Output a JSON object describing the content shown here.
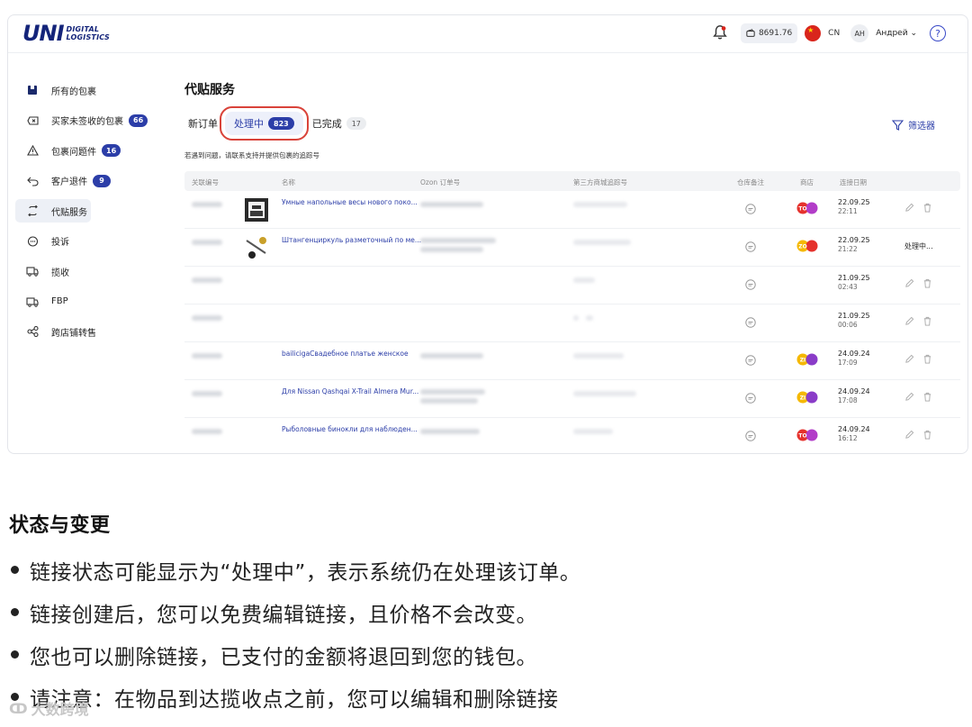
{
  "header": {
    "logo_main": "UNI",
    "logo_line1": "DIGITAL",
    "logo_line2": "LOGISTICS",
    "balance": "8691.76",
    "language": "CN",
    "avatar_initials": "AH",
    "username": "Андрей",
    "help_label": "?"
  },
  "sidebar": {
    "items": [
      {
        "label": "所有的包裹",
        "icon": "box-icon"
      },
      {
        "label": "买家未签收的包裹",
        "icon": "cancel-box-icon",
        "badge": "66"
      },
      {
        "label": "包裹问题件",
        "icon": "warning-icon",
        "badge": "16"
      },
      {
        "label": "客户退件",
        "icon": "return-icon",
        "badge": "9"
      },
      {
        "label": "代贴服务",
        "icon": "relabel-icon",
        "active": true
      },
      {
        "label": "投诉",
        "icon": "complaint-icon"
      },
      {
        "label": "揽收",
        "icon": "truck-icon"
      },
      {
        "label": "FBP",
        "icon": "fbp-truck-icon"
      },
      {
        "label": "跨店铺转售",
        "icon": "share-icon"
      }
    ]
  },
  "main": {
    "title": "代贴服务",
    "tabs": [
      {
        "label": "新订单"
      },
      {
        "label": "处理中",
        "count": "823"
      },
      {
        "label": "已完成",
        "count": "17"
      }
    ],
    "filter_label": "筛选器",
    "notice": "若遇到问题，请联系支持并提供包裹的追踪号"
  },
  "table": {
    "columns": [
      "关联编号",
      "名称",
      "Ozon 订单号",
      "第三方商城追踪号",
      "仓库备注",
      "商店",
      "连接日期"
    ],
    "rows": [
      {
        "name": "Умные напольные весы нового поко...",
        "image": "scale",
        "shop": "TO",
        "date": "22.09.25",
        "time": "22:11",
        "status": ""
      },
      {
        "name": "Штангенциркуль разметочный по ме...",
        "image": "caliper",
        "shop": "ZO",
        "date": "22.09.25",
        "time": "21:22",
        "status": "处理中..."
      },
      {
        "name": "",
        "image": "",
        "shop": "",
        "date": "21.09.25",
        "time": "02:43",
        "status": ""
      },
      {
        "name": "",
        "image": "",
        "shop": "",
        "date": "21.09.25",
        "time": "00:06",
        "status": ""
      },
      {
        "name": "bailicigaСвадебное платье женское",
        "image": "",
        "shop": "ZI",
        "date": "24.09.24",
        "time": "17:09",
        "status": ""
      },
      {
        "name": "Для Nissan Qashqai X-Trail Almera Mur...",
        "image": "",
        "shop": "ZI",
        "date": "24.09.24",
        "time": "17:08",
        "status": ""
      },
      {
        "name": "Рыболовные бинокли для наблюден...",
        "image": "",
        "shop": "TO",
        "date": "24.09.24",
        "time": "16:12",
        "status": ""
      }
    ]
  },
  "section": {
    "title": "状态与变更",
    "bullets": [
      "链接状态可能显示为“处理中”，表示系统仍在处理该订单。",
      "链接创建后，您可以免费编辑链接，且价格不会改变。",
      "您也可以删除链接，已支付的金额将退回到您的钱包。",
      "请注意：在物品到达揽收点之前，您可以编辑和删除链接"
    ]
  },
  "watermark": "大数跨境",
  "colors": {
    "brand": "#14247a",
    "accent": "#2c3ea8",
    "highlight": "#d9433a"
  }
}
